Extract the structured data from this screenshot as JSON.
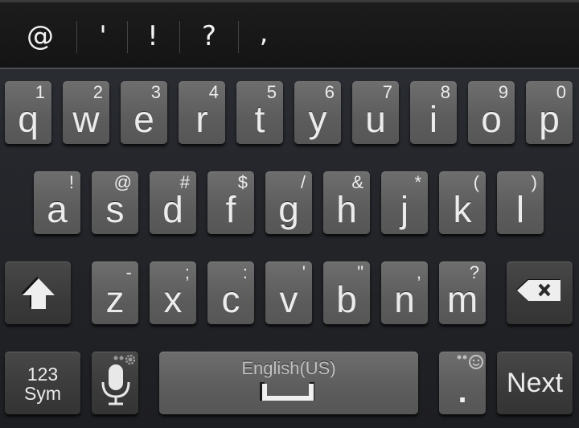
{
  "suggestions": [
    "@",
    "'",
    "!",
    "?",
    ","
  ],
  "rows": [
    [
      {
        "main": "q",
        "alt": "1"
      },
      {
        "main": "w",
        "alt": "2"
      },
      {
        "main": "e",
        "alt": "3"
      },
      {
        "main": "r",
        "alt": "4"
      },
      {
        "main": "t",
        "alt": "5"
      },
      {
        "main": "y",
        "alt": "6"
      },
      {
        "main": "u",
        "alt": "7"
      },
      {
        "main": "i",
        "alt": "8"
      },
      {
        "main": "o",
        "alt": "9"
      },
      {
        "main": "p",
        "alt": "0"
      }
    ],
    [
      {
        "main": "a",
        "alt": "!"
      },
      {
        "main": "s",
        "alt": "@"
      },
      {
        "main": "d",
        "alt": "#"
      },
      {
        "main": "f",
        "alt": "$"
      },
      {
        "main": "g",
        "alt": "/"
      },
      {
        "main": "h",
        "alt": "&"
      },
      {
        "main": "j",
        "alt": "*"
      },
      {
        "main": "k",
        "alt": "("
      },
      {
        "main": "l",
        "alt": ")"
      }
    ],
    [
      {
        "main": "z",
        "alt": "-"
      },
      {
        "main": "x",
        "alt": ";"
      },
      {
        "main": "c",
        "alt": ":"
      },
      {
        "main": "v",
        "alt": "'"
      },
      {
        "main": "b",
        "alt": "\""
      },
      {
        "main": "n",
        "alt": ","
      },
      {
        "main": "m",
        "alt": "?"
      }
    ]
  ],
  "special": {
    "shift_icon": "shift-arrow-icon",
    "delete_icon": "backspace-icon",
    "sym_line1": "123",
    "sym_line2": "Sym",
    "mic_icon": "microphone-icon",
    "settings_icon": "gear-icon",
    "space_label": "English(US)",
    "space_icon": "space-bar-icon",
    "period": ".",
    "emoji_icon": "smiley-icon",
    "next_label": "Next"
  }
}
